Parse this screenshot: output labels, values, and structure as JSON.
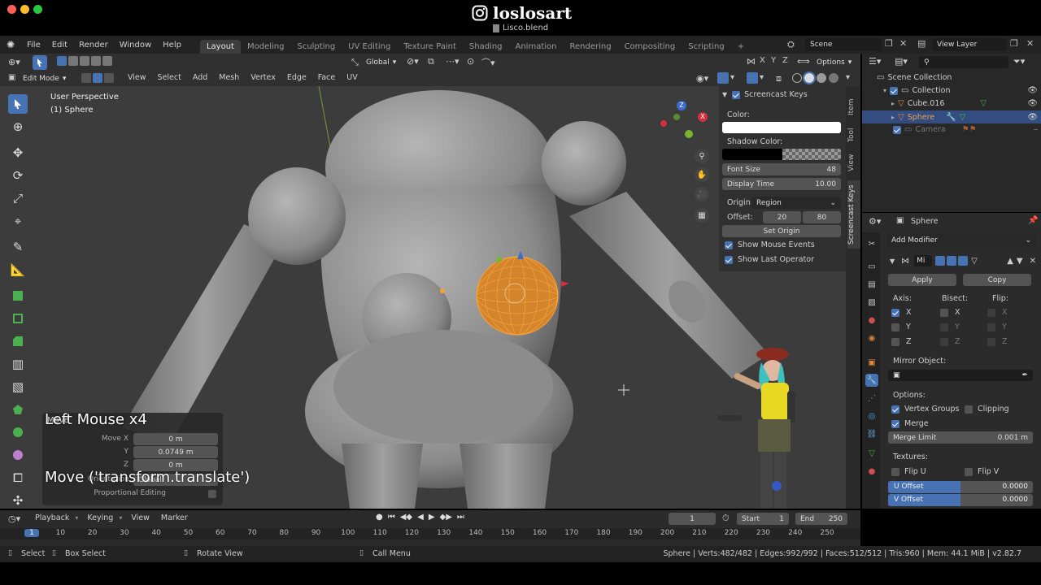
{
  "window": {
    "watermark": "loslosart",
    "file_name": "Lisco.blend"
  },
  "topbar": {
    "menus": [
      "File",
      "Edit",
      "Render",
      "Window",
      "Help"
    ],
    "workspaces": [
      "Layout",
      "Modeling",
      "Sculpting",
      "UV Editing",
      "Texture Paint",
      "Shading",
      "Animation",
      "Rendering",
      "Compositing",
      "Scripting"
    ],
    "add_tab": "+",
    "scene": "Scene",
    "view_layer": "View Layer"
  },
  "viewport_header": {
    "orientation": "Global",
    "options": "Options",
    "axis_x": "X",
    "axis_y": "Y",
    "axis_z": "Z",
    "mode": "Edit Mode",
    "menus": [
      "View",
      "Select",
      "Add",
      "Mesh",
      "Vertex",
      "Edge",
      "Face",
      "UV"
    ]
  },
  "viewport": {
    "perspective": "User Perspective",
    "object": "(1) Sphere",
    "screencast_key": "Left Mouse x4",
    "screencast_op": "Move ('transform.translate')",
    "op_panel": {
      "title": "Move",
      "move_x_label": "Move X",
      "move_x": "0 m",
      "y_label": "Y",
      "y": "0.0749 m",
      "z_label": "Z",
      "z": "0 m",
      "orientation_label": "Orientation",
      "orientation": "Global",
      "proportional": "Proportional Editing"
    },
    "gizmo": {
      "x": "X",
      "y": "Y",
      "z": "Z"
    }
  },
  "npanel": {
    "header": "Screencast Keys",
    "color_label": "Color:",
    "color": "#ffffff",
    "shadow_label": "Shadow Color:",
    "font_size_label": "Font Size",
    "font_size": "48",
    "display_time_label": "Display Time",
    "display_time": "10.00",
    "origin_label": "Origin:",
    "origin": "Region",
    "offset_label": "Offset:",
    "offset_x": "20",
    "offset_y": "80",
    "set_origin": "Set Origin",
    "show_mouse": "Show Mouse Events",
    "show_op": "Show Last Operator",
    "tabs": [
      "Item",
      "Tool",
      "View",
      "Screencast Keys"
    ]
  },
  "outliner": {
    "scene_collection": "Scene Collection",
    "items": [
      {
        "name": "Collection"
      },
      {
        "name": "Cube.016"
      },
      {
        "name": "Sphere"
      },
      {
        "name": "Camera"
      }
    ]
  },
  "properties": {
    "object": "Sphere",
    "add_modifier": "Add Modifier",
    "modifier_name": "Mi",
    "apply": "Apply",
    "copy": "Copy",
    "axis_label": "Axis:",
    "bisect_label": "Bisect:",
    "flip_label": "Flip:",
    "x": "X",
    "y": "Y",
    "z": "Z",
    "mirror_object": "Mirror Object:",
    "options": "Options:",
    "vertex_groups": "Vertex Groups",
    "clipping": "Clipping",
    "merge": "Merge",
    "merge_limit_label": "Merge Limit",
    "merge_limit": "0.001 m",
    "textures": "Textures:",
    "flip_u": "Flip U",
    "flip_v": "Flip V",
    "u_offset_label": "U Offset",
    "u_offset": "0.0000",
    "v_offset_label": "V Offset",
    "v_offset": "0.0000"
  },
  "timeline": {
    "menus": [
      "Playback",
      "Keying",
      "View",
      "Marker"
    ],
    "current_frame": "1",
    "start_label": "Start",
    "start": "1",
    "end_label": "End",
    "end": "250",
    "ticks": [
      "1",
      "10",
      "20",
      "30",
      "40",
      "50",
      "60",
      "70",
      "80",
      "90",
      "100",
      "110",
      "120",
      "130",
      "140",
      "150",
      "160",
      "170",
      "180",
      "190",
      "200",
      "210",
      "220",
      "230",
      "240",
      "250"
    ]
  },
  "statusbar": {
    "select": "Select",
    "box_select": "Box Select",
    "rotate": "Rotate View",
    "call_menu": "Call Menu",
    "stats": "Sphere | Verts:482/482 | Edges:992/992 | Faces:512/512 | Tris:960 | Mem: 44.1 MiB | v2.82.7"
  }
}
